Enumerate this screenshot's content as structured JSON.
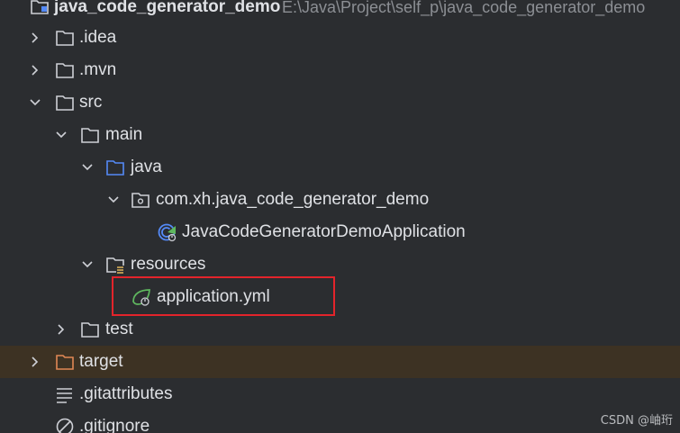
{
  "project": {
    "name": "java_code_generator_demo",
    "path": "E:\\Java\\Project\\self_p\\java_code_generator_demo"
  },
  "tree": {
    "idea": ".idea",
    "mvn": ".mvn",
    "src": "src",
    "main": "main",
    "java": "java",
    "package": "com.xh.java_code_generator_demo",
    "app_class": "JavaCodeGeneratorDemoApplication",
    "resources": "resources",
    "app_yml": "application.yml",
    "test": "test",
    "target": "target",
    "gitattributes": ".gitattributes",
    "gitignore": ".gitignore"
  },
  "colors": {
    "background": "#2b2d30",
    "excluded_row": "#3d3223",
    "highlight_box": "#e3242b",
    "source_folder": "#548af7",
    "spring_green": "#5fb85f"
  },
  "watermark": "CSDN @岫珩"
}
